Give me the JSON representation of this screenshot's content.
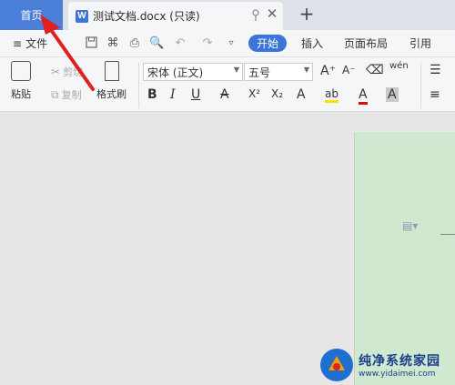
{
  "tabs": {
    "home": "首页",
    "doc_title": "测试文档.docx (只读)",
    "doc_icon_letter": "W",
    "new_tab": "+"
  },
  "menu": {
    "file": "文件",
    "start": "开始",
    "insert": "插入",
    "layout": "页面布局",
    "references": "引用"
  },
  "ribbon": {
    "paste": "粘贴",
    "cut": "剪切",
    "copy": "复制",
    "format_painter": "格式刷",
    "font_name": "宋体 (正文)",
    "font_size": "五号",
    "bold": "B",
    "italic": "I",
    "underline": "U",
    "strikethrough": "A",
    "superscript": "X²",
    "subscript": "X₂",
    "font_color_a": "A",
    "highlight": "ab",
    "font_color": "A",
    "char_shading": "A",
    "grow_font": "A⁺",
    "shrink_font": "A⁻",
    "pinyin": "wén"
  },
  "watermark": {
    "title": "纯净系统家园",
    "url": "www.yidaimei.com"
  },
  "colors": {
    "accent": "#3d74d9",
    "home_tab": "#4c7fd8",
    "page_bg": "#cfe8cf",
    "arrow": "#e02020"
  }
}
